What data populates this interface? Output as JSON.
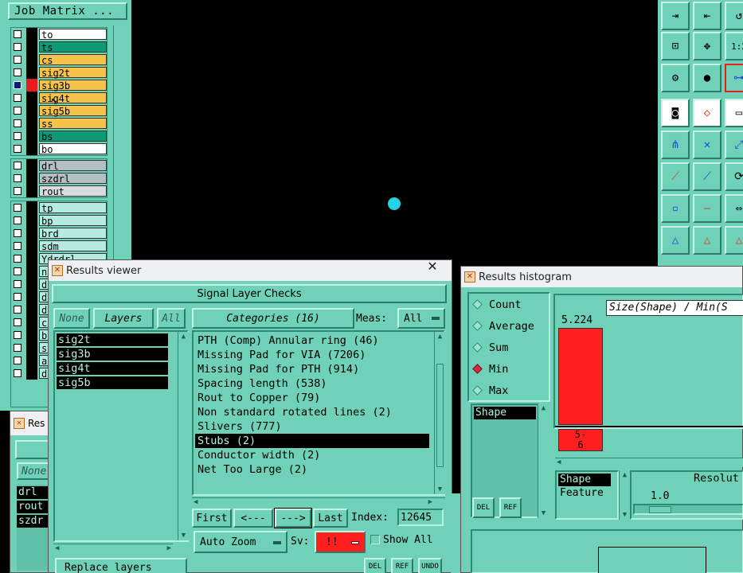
{
  "job_matrix": {
    "title": "Job Matrix ...",
    "group1": [
      {
        "name": "to",
        "color": "#ffffff",
        "selected": false,
        "red": false
      },
      {
        "name": "ts",
        "color": "#0e9a76",
        "selected": false,
        "red": false
      },
      {
        "name": "cs",
        "color": "#f5c24a",
        "selected": false,
        "red": false
      },
      {
        "name": "sig2t",
        "color": "#f5c24a",
        "selected": false,
        "red": false
      },
      {
        "name": "sig3b",
        "color": "#f5c24a",
        "selected": true,
        "red": true
      },
      {
        "name": "sig4t",
        "color": "#f5c24a",
        "selected": false,
        "red": false
      },
      {
        "name": "sig5b",
        "color": "#f5c24a",
        "selected": false,
        "red": false
      },
      {
        "name": "ss",
        "color": "#f5c24a",
        "selected": false,
        "red": false
      },
      {
        "name": "bs",
        "color": "#0e9a76",
        "selected": false,
        "red": false
      },
      {
        "name": "bo",
        "color": "#ffffff",
        "selected": false,
        "red": false
      }
    ],
    "group2": [
      {
        "name": "drl",
        "color": "#b4bfc3"
      },
      {
        "name": "szdrl",
        "color": "#b4bfc3"
      },
      {
        "name": "rout",
        "color": "#d8dcde"
      }
    ],
    "group3": [
      {
        "name": "tp",
        "color": "#b6ece0"
      },
      {
        "name": "bp",
        "color": "#b6ece0"
      },
      {
        "name": "brd",
        "color": "#b6ece0"
      },
      {
        "name": "sdm",
        "color": "#b6ece0"
      },
      {
        "name": "Ydrdrl",
        "color": "#b6ece0"
      }
    ],
    "partial_letters": [
      "n",
      "d",
      "d",
      "d",
      "c",
      "b",
      "s",
      "a",
      "d"
    ]
  },
  "mini_window": {
    "title": "Res",
    "none_label": "None",
    "items": [
      "drl",
      "rout",
      "szdr"
    ]
  },
  "results_viewer": {
    "title": "Results viewer",
    "header": "Signal Layer Checks",
    "none_btn": "None",
    "layers_btn": "Layers",
    "all_btn": "All",
    "categories_btn": "Categories (16)",
    "meas_label": "Meas:",
    "meas_value": "All",
    "layers": [
      "sig2t",
      "sig3b",
      "sig4t",
      "sig5b"
    ],
    "categories": [
      {
        "text": "PTH (Comp) Annular ring (46)",
        "selected": false
      },
      {
        "text": "Missing Pad for VIA (7206)",
        "selected": false
      },
      {
        "text": "Missing Pad for PTH (914)",
        "selected": false
      },
      {
        "text": "Spacing length (538)",
        "selected": false
      },
      {
        "text": "Rout to Copper (79)",
        "selected": false
      },
      {
        "text": "Non standard rotated lines (2)",
        "selected": false
      },
      {
        "text": "Slivers (777)",
        "selected": false
      },
      {
        "text": "Stubs (2)",
        "selected": true
      },
      {
        "text": "Conductor width (2)",
        "selected": false
      },
      {
        "text": "Net Too Large (2)",
        "selected": false
      }
    ],
    "first_btn": "First",
    "prev_btn": "<---",
    "next_btn": "--->",
    "last_btn": "Last",
    "index_label": "Index:",
    "index_value": "12645",
    "auto_zoom": "Auto Zoom",
    "sv_label": "Sv:",
    "sv_value": "!!",
    "show_all": "Show All",
    "replace_layers": "Replace layers",
    "del": "DEL",
    "ref": "REF",
    "undo": "UNDO"
  },
  "histogram": {
    "title": "Results histogram",
    "modes": [
      {
        "label": "Count",
        "on": false
      },
      {
        "label": "Average",
        "on": false
      },
      {
        "label": "Sum",
        "on": false
      },
      {
        "label": "Min",
        "on": true
      },
      {
        "label": "Max",
        "on": false
      }
    ],
    "chart_title": "Size(Shape) / Min(S",
    "bar_value": "5.224",
    "bar_label": "5-\n6",
    "list_items": [
      "Shape"
    ],
    "shape_feature": [
      "Shape",
      "Feature"
    ],
    "resolution_label": "Resolut",
    "resolution_value": "1.0",
    "del": "DEL",
    "ref": "REF"
  },
  "canvas": {
    "dot_color": "#22d3e6"
  },
  "colors": {
    "panel": "#6fd1b8",
    "dark_panel": "#5ec1a8",
    "red": "#ff1f1f"
  }
}
